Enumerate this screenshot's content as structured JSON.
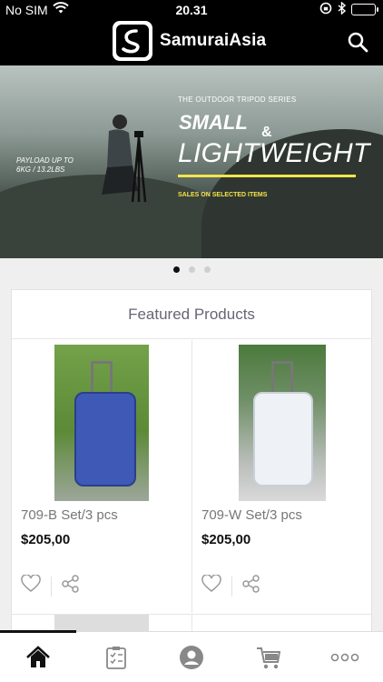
{
  "status_bar": {
    "carrier": "No SIM",
    "time": "20.31",
    "battery_level": 1.0
  },
  "header": {
    "app_name": "SamuraiAsia",
    "logo_icon": "samurai-logo-icon",
    "search_icon": "search-icon"
  },
  "banner": {
    "series_label": "THE OUTDOOR TRIPOD SERIES",
    "headline_1": "SMALL",
    "headline_amp": "&",
    "headline_2": "LIGHTWEIGHT",
    "payload_line_1": "PAYLOAD UP TO",
    "payload_line_2": "6KG / 13.2LBS",
    "sales_text": "SALES ON SELECTED ITEMS",
    "accent_color": "#f3e54a",
    "slides_total": 3,
    "active_slide": 1
  },
  "featured": {
    "title": "Featured Products",
    "products": [
      {
        "name": "709-B Set/3 pcs",
        "price": "$205,00",
        "color": "#3f59b7"
      },
      {
        "name": "709-W Set/3 pcs",
        "price": "$205,00",
        "color": "#eef2f6"
      }
    ]
  },
  "tabbar": {
    "items": [
      "home-icon",
      "orders-icon",
      "account-icon",
      "cart-icon",
      "more-icon"
    ],
    "active": 0
  }
}
